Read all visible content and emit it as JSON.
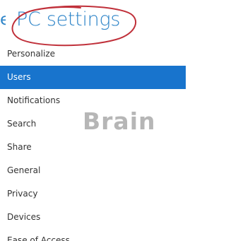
{
  "header": {
    "title_prefix": "e",
    "title": "PC settings"
  },
  "menu": {
    "selected_index": 1,
    "items": [
      {
        "label": "Personalize"
      },
      {
        "label": "Users"
      },
      {
        "label": "Notifications"
      },
      {
        "label": "Search"
      },
      {
        "label": "Share"
      },
      {
        "label": "General"
      },
      {
        "label": "Privacy"
      },
      {
        "label": "Devices"
      },
      {
        "label": "Ease of Access"
      }
    ]
  },
  "watermark": {
    "text": "Brain"
  },
  "colors": {
    "accent_title": "#2d84c8",
    "selection_background": "#1874cd",
    "annotation_circle": "#c0303a",
    "menu_text": "#333333"
  }
}
